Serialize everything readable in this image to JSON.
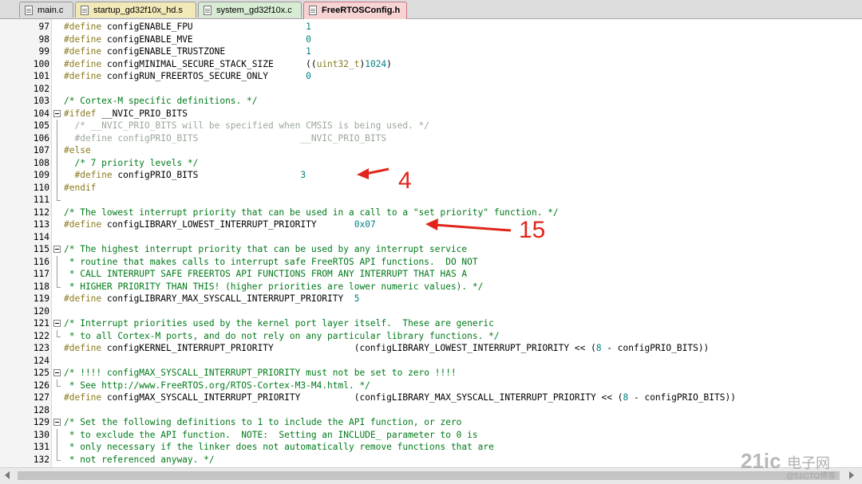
{
  "tabs": [
    {
      "label": "main.c",
      "active": false
    },
    {
      "label": "startup_gd32f10x_hd.s",
      "active": false
    },
    {
      "label": "system_gd32f10x.c",
      "active": false
    },
    {
      "label": "FreeRTOSConfig.h",
      "active": true
    }
  ],
  "lines": [
    {
      "n": "97",
      "fold": "",
      "segs": [
        {
          "t": "kw",
          "v": "#define"
        },
        {
          "t": "id",
          "v": " configENABLE_FPU                     "
        },
        {
          "t": "num",
          "v": "1"
        }
      ]
    },
    {
      "n": "98",
      "fold": "",
      "segs": [
        {
          "t": "kw",
          "v": "#define"
        },
        {
          "t": "id",
          "v": " configENABLE_MVE                     "
        },
        {
          "t": "num",
          "v": "0"
        }
      ]
    },
    {
      "n": "99",
      "fold": "",
      "segs": [
        {
          "t": "kw",
          "v": "#define"
        },
        {
          "t": "id",
          "v": " configENABLE_TRUSTZONE               "
        },
        {
          "t": "num",
          "v": "1"
        }
      ]
    },
    {
      "n": "100",
      "fold": "",
      "segs": [
        {
          "t": "kw",
          "v": "#define"
        },
        {
          "t": "id",
          "v": " configMINIMAL_SECURE_STACK_SIZE      (("
        },
        {
          "t": "kw",
          "v": "uint32_t"
        },
        {
          "t": "id",
          "v": ")"
        },
        {
          "t": "num",
          "v": "1024"
        },
        {
          "t": "id",
          "v": ")"
        }
      ]
    },
    {
      "n": "101",
      "fold": "",
      "segs": [
        {
          "t": "kw",
          "v": "#define"
        },
        {
          "t": "id",
          "v": " configRUN_FREERTOS_SECURE_ONLY       "
        },
        {
          "t": "num",
          "v": "0"
        }
      ]
    },
    {
      "n": "102",
      "fold": "",
      "segs": []
    },
    {
      "n": "103",
      "fold": "",
      "segs": [
        {
          "t": "cm",
          "v": "/* Cortex-M specific definitions. */"
        }
      ]
    },
    {
      "n": "104",
      "fold": "box",
      "segs": [
        {
          "t": "kw",
          "v": "#ifdef"
        },
        {
          "t": "id",
          "v": " __NVIC_PRIO_BITS"
        }
      ]
    },
    {
      "n": "105",
      "fold": "vline",
      "segs": [
        {
          "t": "gr",
          "v": "  /* __NVIC_PRIO_BITS will be specified when CMSIS is being used. */"
        }
      ]
    },
    {
      "n": "106",
      "fold": "vline",
      "segs": [
        {
          "t": "gr",
          "v": "  #define configPRIO_BITS                   __NVIC_PRIO_BITS"
        }
      ]
    },
    {
      "n": "107",
      "fold": "vline",
      "segs": [
        {
          "t": "kw",
          "v": "#else"
        }
      ]
    },
    {
      "n": "108",
      "fold": "vline",
      "segs": [
        {
          "t": "cm",
          "v": "  /* 7 priority levels */"
        }
      ]
    },
    {
      "n": "109",
      "fold": "vline",
      "segs": [
        {
          "t": "kw",
          "v": "  #define"
        },
        {
          "t": "id",
          "v": " configPRIO_BITS                   "
        },
        {
          "t": "num",
          "v": "3"
        }
      ]
    },
    {
      "n": "110",
      "fold": "vline",
      "segs": [
        {
          "t": "kw",
          "v": "#endif"
        }
      ]
    },
    {
      "n": "111",
      "fold": "end",
      "segs": []
    },
    {
      "n": "112",
      "fold": "",
      "segs": [
        {
          "t": "cm",
          "v": "/* The lowest interrupt priority that can be used in a call to a \"set priority\" function. */"
        }
      ]
    },
    {
      "n": "113",
      "fold": "",
      "segs": [
        {
          "t": "kw",
          "v": "#define"
        },
        {
          "t": "id",
          "v": " configLIBRARY_LOWEST_INTERRUPT_PRIORITY       "
        },
        {
          "t": "num",
          "v": "0x07"
        }
      ]
    },
    {
      "n": "114",
      "fold": "",
      "segs": []
    },
    {
      "n": "115",
      "fold": "box",
      "segs": [
        {
          "t": "cm",
          "v": "/* The highest interrupt priority that can be used by any interrupt service"
        }
      ]
    },
    {
      "n": "116",
      "fold": "vline",
      "segs": [
        {
          "t": "cm",
          "v": " * routine that makes calls to interrupt safe FreeRTOS API functions.  DO NOT"
        }
      ]
    },
    {
      "n": "117",
      "fold": "vline",
      "segs": [
        {
          "t": "cm",
          "v": " * CALL INTERRUPT SAFE FREERTOS API FUNCTIONS FROM ANY INTERRUPT THAT HAS A"
        }
      ]
    },
    {
      "n": "118",
      "fold": "end",
      "segs": [
        {
          "t": "cm",
          "v": " * HIGHER PRIORITY THAN THIS! (higher priorities are lower numeric values). */"
        }
      ]
    },
    {
      "n": "119",
      "fold": "",
      "segs": [
        {
          "t": "kw",
          "v": "#define"
        },
        {
          "t": "id",
          "v": " configLIBRARY_MAX_SYSCALL_INTERRUPT_PRIORITY  "
        },
        {
          "t": "num",
          "v": "5"
        }
      ]
    },
    {
      "n": "120",
      "fold": "",
      "segs": []
    },
    {
      "n": "121",
      "fold": "box",
      "segs": [
        {
          "t": "cm",
          "v": "/* Interrupt priorities used by the kernel port layer itself.  These are generic"
        }
      ]
    },
    {
      "n": "122",
      "fold": "end",
      "segs": [
        {
          "t": "cm",
          "v": " * to all Cortex-M ports, and do not rely on any particular library functions. */"
        }
      ]
    },
    {
      "n": "123",
      "fold": "",
      "segs": [
        {
          "t": "kw",
          "v": "#define"
        },
        {
          "t": "id",
          "v": " configKERNEL_INTERRUPT_PRIORITY               (configLIBRARY_LOWEST_INTERRUPT_PRIORITY << ("
        },
        {
          "t": "num",
          "v": "8"
        },
        {
          "t": "id",
          "v": " - configPRIO_BITS))"
        }
      ]
    },
    {
      "n": "124",
      "fold": "",
      "segs": []
    },
    {
      "n": "125",
      "fold": "box",
      "segs": [
        {
          "t": "cm",
          "v": "/* !!!! configMAX_SYSCALL_INTERRUPT_PRIORITY must not be set to zero !!!!"
        }
      ]
    },
    {
      "n": "126",
      "fold": "end",
      "segs": [
        {
          "t": "cm",
          "v": " * See http://www.FreeRTOS.org/RTOS-Cortex-M3-M4.html. */"
        }
      ]
    },
    {
      "n": "127",
      "fold": "",
      "segs": [
        {
          "t": "kw",
          "v": "#define"
        },
        {
          "t": "id",
          "v": " configMAX_SYSCALL_INTERRUPT_PRIORITY          (configLIBRARY_MAX_SYSCALL_INTERRUPT_PRIORITY << ("
        },
        {
          "t": "num",
          "v": "8"
        },
        {
          "t": "id",
          "v": " - configPRIO_BITS))"
        }
      ]
    },
    {
      "n": "128",
      "fold": "",
      "segs": []
    },
    {
      "n": "129",
      "fold": "box",
      "segs": [
        {
          "t": "cm",
          "v": "/* Set the following definitions to 1 to include the API function, or zero"
        }
      ]
    },
    {
      "n": "130",
      "fold": "vline",
      "segs": [
        {
          "t": "cm",
          "v": " * to exclude the API function.  NOTE:  Setting an INCLUDE_ parameter to 0 is"
        }
      ]
    },
    {
      "n": "131",
      "fold": "vline",
      "segs": [
        {
          "t": "cm",
          "v": " * only necessary if the linker does not automatically remove functions that are"
        }
      ]
    },
    {
      "n": "132",
      "fold": "end",
      "segs": [
        {
          "t": "cm",
          "v": " * not referenced anyway. */"
        }
      ]
    }
  ],
  "annotations": {
    "a1": "4",
    "a2": "15"
  },
  "watermark": {
    "logo": "21ic",
    "cn": "电子网",
    "sub": "@51CTO博客"
  },
  "colors": {
    "annotation": "#e0251b",
    "active_tab": "#f7d4d4"
  },
  "icons": {
    "tab_file": "file-icon",
    "arrow": "arrow-left-icon"
  }
}
